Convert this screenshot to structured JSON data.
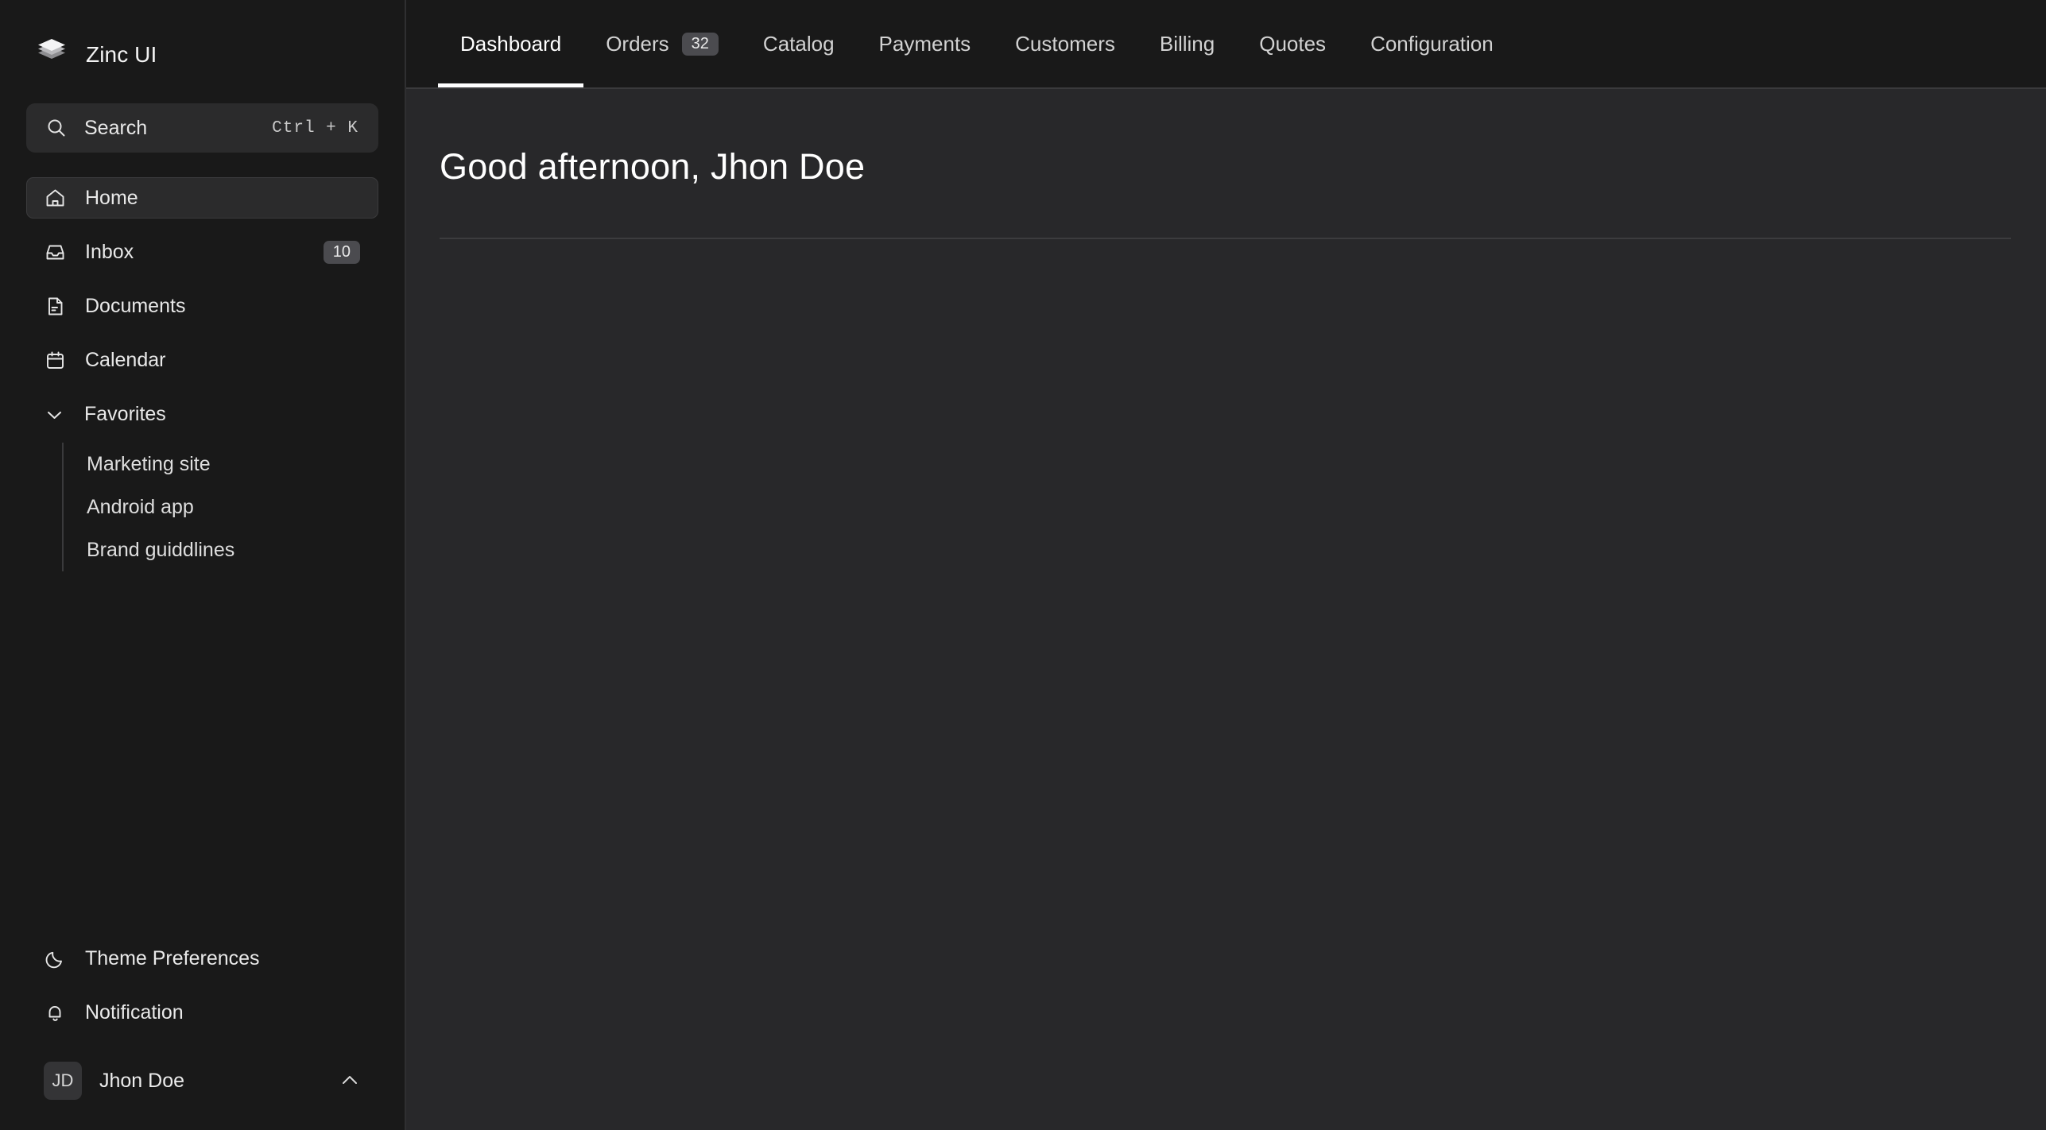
{
  "sidebar": {
    "brand": {
      "name": "Zinc UI",
      "logo_icon": "layers-stack-icon"
    },
    "search": {
      "label": "Search",
      "shortcut": "Ctrl + K",
      "icon": "search-icon"
    },
    "nav": [
      {
        "label": "Home",
        "icon": "home-icon",
        "active": true,
        "badge": ""
      },
      {
        "label": "Inbox",
        "icon": "inbox-icon",
        "active": false,
        "badge": "10"
      },
      {
        "label": "Documents",
        "icon": "document-icon",
        "active": false,
        "badge": ""
      },
      {
        "label": "Calendar",
        "icon": "calendar-icon",
        "active": false,
        "badge": ""
      }
    ],
    "group": {
      "label": "Favorites",
      "icon": "chevron-down-icon",
      "expanded": true,
      "items": [
        {
          "label": "Marketing site"
        },
        {
          "label": "Android app"
        },
        {
          "label": "Brand guiddlines"
        }
      ]
    },
    "bottom": [
      {
        "label": "Theme Preferences",
        "icon": "moon-icon"
      },
      {
        "label": "Notification",
        "icon": "bell-icon"
      }
    ],
    "user": {
      "initials": "JD",
      "name": "Jhon Doe",
      "chevron_icon": "chevron-up-icon"
    }
  },
  "topbar": {
    "tabs": [
      {
        "label": "Dashboard",
        "badge": "",
        "active": true
      },
      {
        "label": "Orders",
        "badge": "32",
        "active": false
      },
      {
        "label": "Catalog",
        "badge": "",
        "active": false
      },
      {
        "label": "Payments",
        "badge": "",
        "active": false
      },
      {
        "label": "Customers",
        "badge": "",
        "active": false
      },
      {
        "label": "Billing",
        "badge": "",
        "active": false
      },
      {
        "label": "Quotes",
        "badge": "",
        "active": false
      },
      {
        "label": "Configuration",
        "badge": "",
        "active": false
      }
    ]
  },
  "main": {
    "greeting": "Good afternoon, Jhon Doe"
  },
  "colors": {
    "sidebar_bg": "#191919",
    "main_bg": "#28282a",
    "surface": "#2b2b2c",
    "badge_bg": "#4b4b4f",
    "text": "#e9e9e9",
    "accent": "#ffffff",
    "divider": "#3c3c3e"
  }
}
